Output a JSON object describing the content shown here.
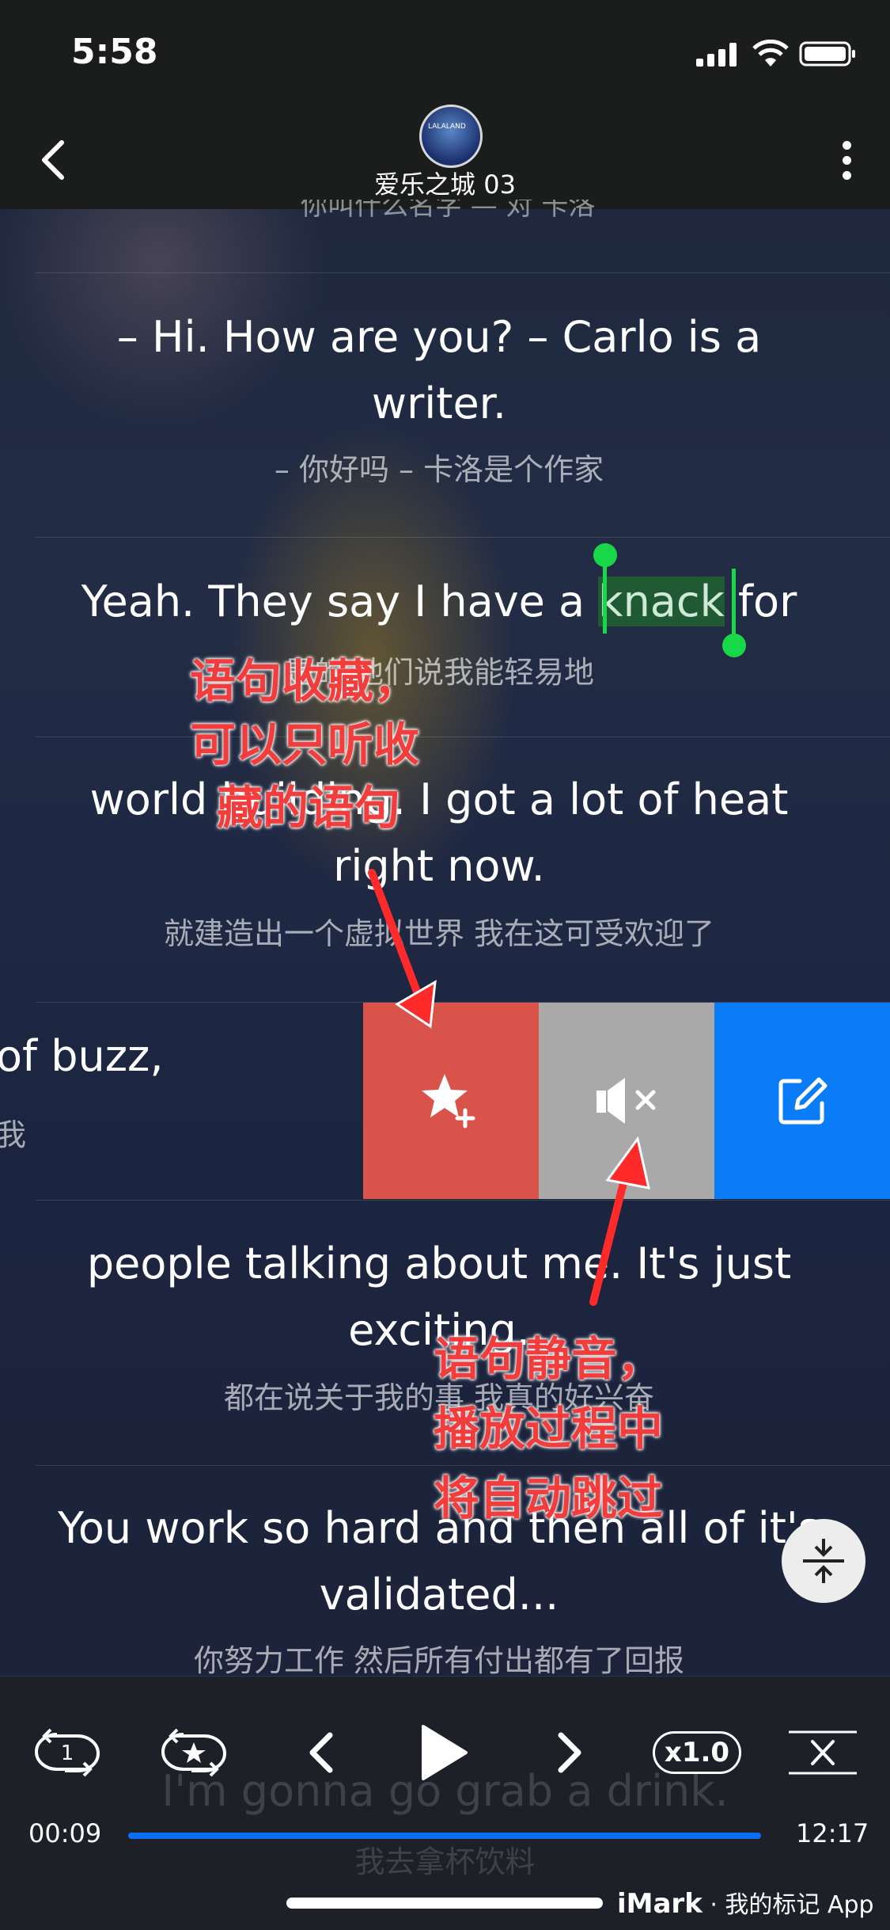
{
  "status_bar": {
    "time": "5:58"
  },
  "nav": {
    "title": "爱乐之城 03",
    "avatar_text": "LALALAND"
  },
  "cut_line_zh": "你叫什么名字 — 对 卡洛",
  "subtitles": [
    {
      "en_line1": "– Hi. How are you? – Carlo is a",
      "en_line2": "writer.",
      "zh": "– 你好吗 – 卡洛是个作家"
    },
    {
      "en_before": "Yeah. They say I have a ",
      "en_highlight": "knack",
      "en_after": " for",
      "zh": "是的 他们说我能轻易地"
    },
    {
      "en_line1": "world building. I got a lot of heat",
      "en_line2": "right now.",
      "zh": "就建造出一个虚拟世界 我在这可受欢迎了"
    },
    {
      "en_line1": "of buzz,",
      "zh": "我"
    },
    {
      "en_line1": "people talking about me. It's just",
      "en_line2": "exciting.",
      "zh": "都在说关于我的事 我真的好兴奋"
    },
    {
      "en_line1": "You work so hard and then all of it's",
      "en_line2": "validated...",
      "zh": "你努力工作 然后所有付出都有了回报"
    }
  ],
  "annotations": {
    "favorite": [
      "语句收藏，",
      "可以只听收",
      "藏的语句"
    ],
    "mute": [
      "语句静音，",
      "播放过程中",
      "将自动跳过"
    ]
  },
  "actions": [
    {
      "name": "favorite",
      "icon": "star-plus-icon",
      "color": "#d9534b"
    },
    {
      "name": "mute",
      "icon": "speaker-mute-icon",
      "color": "#a9a9a9"
    },
    {
      "name": "edit",
      "icon": "edit-icon",
      "color": "#0a7cf7"
    }
  ],
  "player": {
    "next_line_en": "I'm gonna go grab a drink.",
    "next_line_zh": "我去拿杯饮料",
    "repeat_count": "1",
    "speed": "x1.0",
    "current_time": "00:09",
    "total_time": "12:17",
    "progress": 0.013
  },
  "watermark": {
    "brand": "iMark",
    "text": " · 我的标记 App"
  }
}
